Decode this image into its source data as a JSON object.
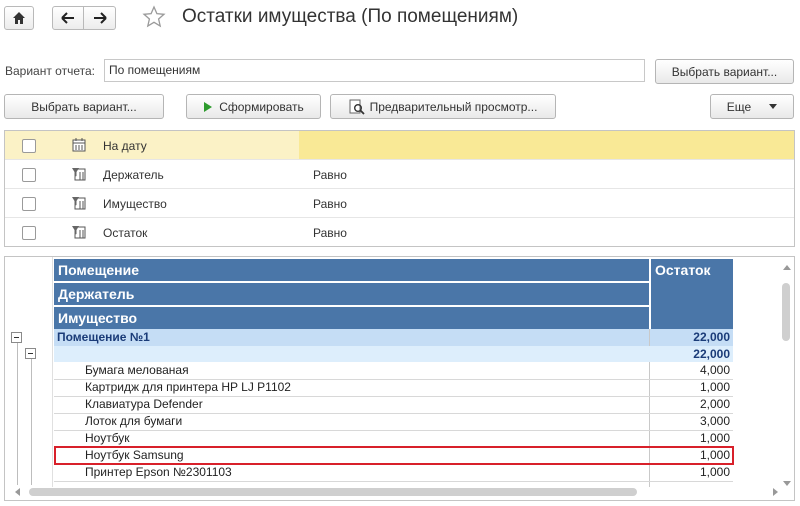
{
  "window": {
    "title": "Остатки имущества (По помещениям)"
  },
  "nav": {
    "home_icon": "home-icon",
    "back_icon": "arrow-left-icon",
    "forward_icon": "arrow-right-icon",
    "favorite_icon": "star-icon"
  },
  "variant": {
    "label": "Вариант отчета:",
    "value": "По помещениям",
    "choose_button": "Выбрать вариант..."
  },
  "toolbar": {
    "choose_variant": "Выбрать вариант...",
    "generate": "Сформировать",
    "preview": "Предварительный просмотр...",
    "more": "Еще"
  },
  "settings": {
    "rows": [
      {
        "name": "На дату",
        "condition": "",
        "checked": false,
        "selected": true
      },
      {
        "name": "Держатель",
        "condition": "Равно",
        "checked": false,
        "selected": false
      },
      {
        "name": "Имущество",
        "condition": "Равно",
        "checked": false,
        "selected": false
      },
      {
        "name": "Остаток",
        "condition": "Равно",
        "checked": false,
        "selected": false
      }
    ]
  },
  "report": {
    "headers": {
      "room": "Помещение",
      "holder": "Держатель",
      "property": "Имущество",
      "balance": "Остаток"
    },
    "group_room": {
      "name": "Помещение №1",
      "value": "22,000"
    },
    "group_holder": {
      "name": "",
      "value": "22,000"
    },
    "items": [
      {
        "name": "Бумага мелованая",
        "value": "4,000"
      },
      {
        "name": "Картридж для принтера HP LJ P1102",
        "value": "1,000"
      },
      {
        "name": "Клавиатура Defender",
        "value": "2,000"
      },
      {
        "name": "Лоток для бумаги",
        "value": "3,000"
      },
      {
        "name": "Ноутбук",
        "value": "1,000"
      },
      {
        "name": "Ноутбук Samsung",
        "value": "1,000"
      },
      {
        "name": "Принтер Epson №2301103",
        "value": "1,000"
      }
    ],
    "highlighted_item": "Ноутбук Samsung"
  },
  "colors": {
    "header_bg": "#4a76a8",
    "group_bg": "#c5ddf5",
    "selection_bg": "#f9e996",
    "highlight_border": "#d8202a",
    "generate_icon": "#2e9b2e"
  }
}
